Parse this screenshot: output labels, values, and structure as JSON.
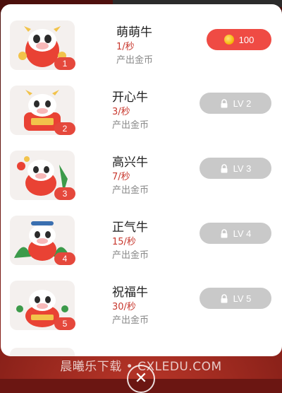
{
  "rows": [
    {
      "name": "萌萌牛",
      "rate": "1/秒",
      "output_label": "产出金币",
      "level": "1",
      "button_label": "100",
      "button_type": "buy",
      "icon": "coin-icon"
    },
    {
      "name": "开心牛",
      "rate": "3/秒",
      "output_label": "产出金币",
      "level": "2",
      "button_label": "LV 2",
      "button_type": "locked",
      "icon": "lock-icon"
    },
    {
      "name": "高兴牛",
      "rate": "7/秒",
      "output_label": "产出金币",
      "level": "3",
      "button_label": "LV 3",
      "button_type": "locked",
      "icon": "lock-icon"
    },
    {
      "name": "正气牛",
      "rate": "15/秒",
      "output_label": "产出金币",
      "level": "4",
      "button_label": "LV 4",
      "button_type": "locked",
      "icon": "lock-icon"
    },
    {
      "name": "祝福牛",
      "rate": "30/秒",
      "output_label": "产出金币",
      "level": "5",
      "button_label": "LV 5",
      "button_type": "locked",
      "icon": "lock-icon"
    }
  ],
  "watermark": "晨曦乐下载 • CXLEDU.COM",
  "close_icon": "close-icon",
  "colors": {
    "buy_button": "#ef4b44",
    "locked_button": "#c9c9c9",
    "rate_text": "#c8382e",
    "level_badge": "#e5483c"
  }
}
